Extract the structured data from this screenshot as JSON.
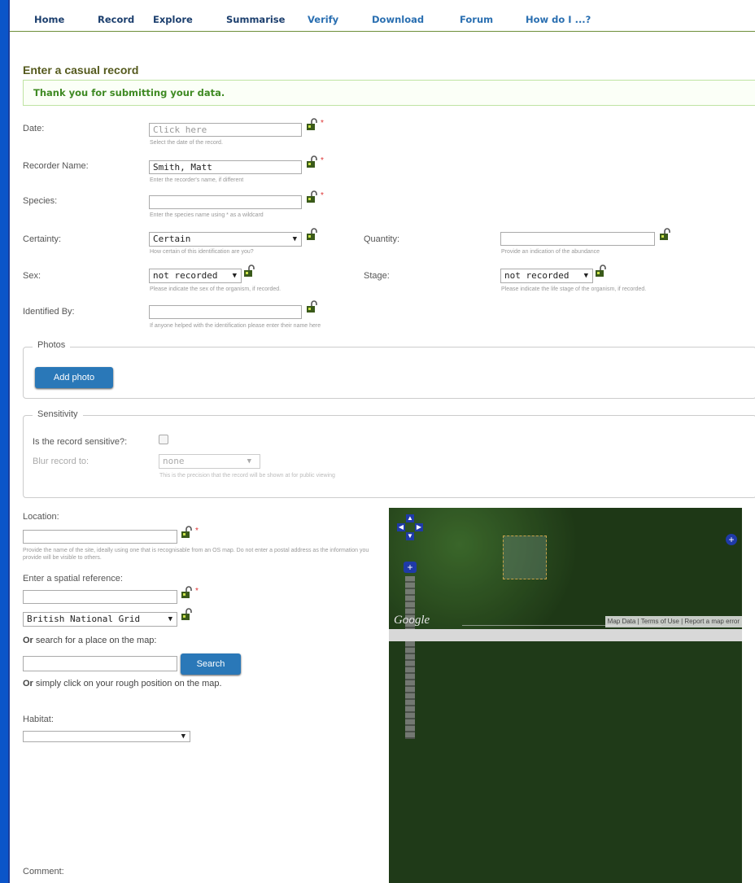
{
  "nav": {
    "items": [
      "Home",
      "Record",
      "Explore",
      "Summarise",
      "Verify",
      "Download",
      "Forum",
      "How do I ...?"
    ]
  },
  "page": {
    "title": "Enter a casual record",
    "success_message": "Thank you for submitting your data."
  },
  "form": {
    "date": {
      "label": "Date:",
      "placeholder": "Click here",
      "help": "Select the date of the record."
    },
    "recorder": {
      "label": "Recorder Name:",
      "value": "Smith, Matt",
      "help": "Enter the recorder's name, if different"
    },
    "species": {
      "label": "Species:",
      "value": "",
      "help": "Enter the species name using * as a wildcard"
    },
    "certainty": {
      "label": "Certainty:",
      "value": "Certain",
      "help": "How certain of this identification are you?"
    },
    "quantity": {
      "label": "Quantity:",
      "value": "",
      "help": "Provide an indication of the abundance"
    },
    "sex": {
      "label": "Sex:",
      "value": "not recorded",
      "help": "Please indicate the sex of the organism, if recorded."
    },
    "stage": {
      "label": "Stage:",
      "value": "not recorded",
      "help": "Please indicate the life stage of the organism, if recorded."
    },
    "identified_by": {
      "label": "Identified By:",
      "value": "",
      "help": "If anyone helped with the identification please enter their name here"
    }
  },
  "photos": {
    "legend": "Photos",
    "add_label": "Add photo"
  },
  "sensitivity": {
    "legend": "Sensitivity",
    "sensitive_label": "Is the record sensitive?:",
    "blur_label": "Blur record to:",
    "blur_value": "none",
    "blur_help": "This is the precision that the record will be shown at for public viewing"
  },
  "location": {
    "label": "Location:",
    "help": "Provide the name of the site, ideally using one that is recognisable from an OS map. Do not enter a postal address as the information you provide will be visible to others.",
    "spatial_label": "Enter a spatial reference:",
    "system_value": "British National Grid",
    "or_word": "Or",
    "search_text": " search for a place on the map:",
    "search_button": "Search",
    "click_text": " simply click on your rough position on the map."
  },
  "habitat": {
    "label": "Habitat:",
    "value": ""
  },
  "comment": {
    "label": "Comment:"
  },
  "map": {
    "google_label": "Google",
    "links": [
      "Map Data",
      "Terms of Use",
      "Report a map error"
    ]
  },
  "colors": {
    "accent": "#2a78b8",
    "border_blue": "#0b55c9",
    "nav_text": "#1c3f6e",
    "success": "#3f8a23"
  }
}
